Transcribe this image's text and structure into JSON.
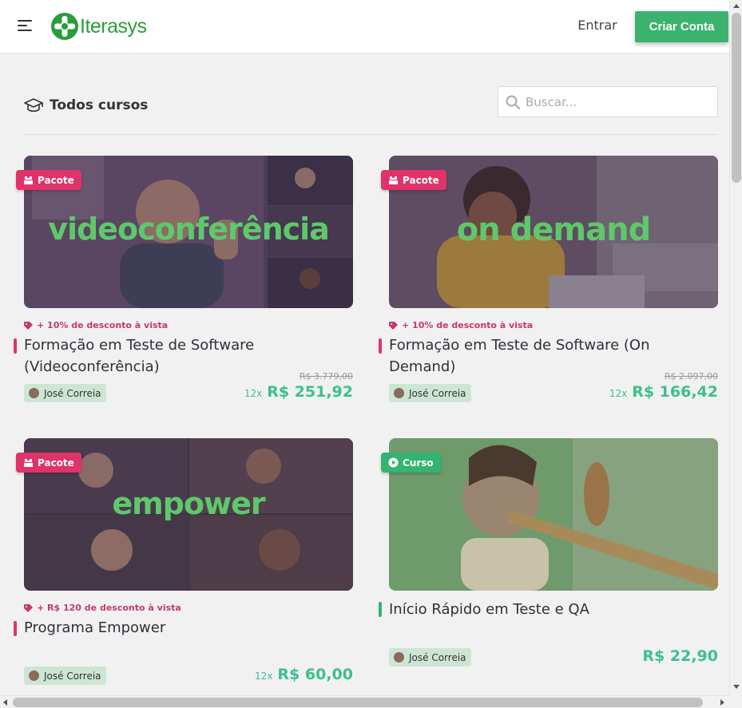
{
  "header": {
    "logo_text": "Iterasys",
    "login_label": "Entrar",
    "signup_label": "Criar Conta"
  },
  "section": {
    "title": "Todos cursos"
  },
  "search": {
    "placeholder": "Buscar..."
  },
  "courses": [
    {
      "badge": "Pacote",
      "overlay_text": "videoconferência",
      "discount": "+ 10% de desconto à vista",
      "title": "Formação em Teste de Software (Videoconferência)",
      "author": "José Correia",
      "old_price": "R$ 3.779,00",
      "installments": "12x",
      "price": "R$ 251,92"
    },
    {
      "badge": "Pacote",
      "overlay_text": "on demand",
      "discount": "+ 10% de desconto à vista",
      "title": "Formação em Teste de Software (On Demand)",
      "author": "José Correia",
      "old_price": "R$ 2.097,00",
      "installments": "12x",
      "price": "R$ 166,42"
    },
    {
      "badge": "Pacote",
      "overlay_text": "empower",
      "discount": "+ R$ 120 de desconto à vista",
      "title": "Programa Empower",
      "author": "José Correia",
      "installments": "12x",
      "price": "R$ 60,00"
    },
    {
      "badge": "Curso",
      "title": "Início Rápido em Teste e QA",
      "author": "José Correia",
      "price": "R$ 22,90"
    }
  ],
  "colors": {
    "brand_green": "#3bb36f",
    "badge_pink": "#e0336a",
    "price_green": "#3cc18c"
  }
}
